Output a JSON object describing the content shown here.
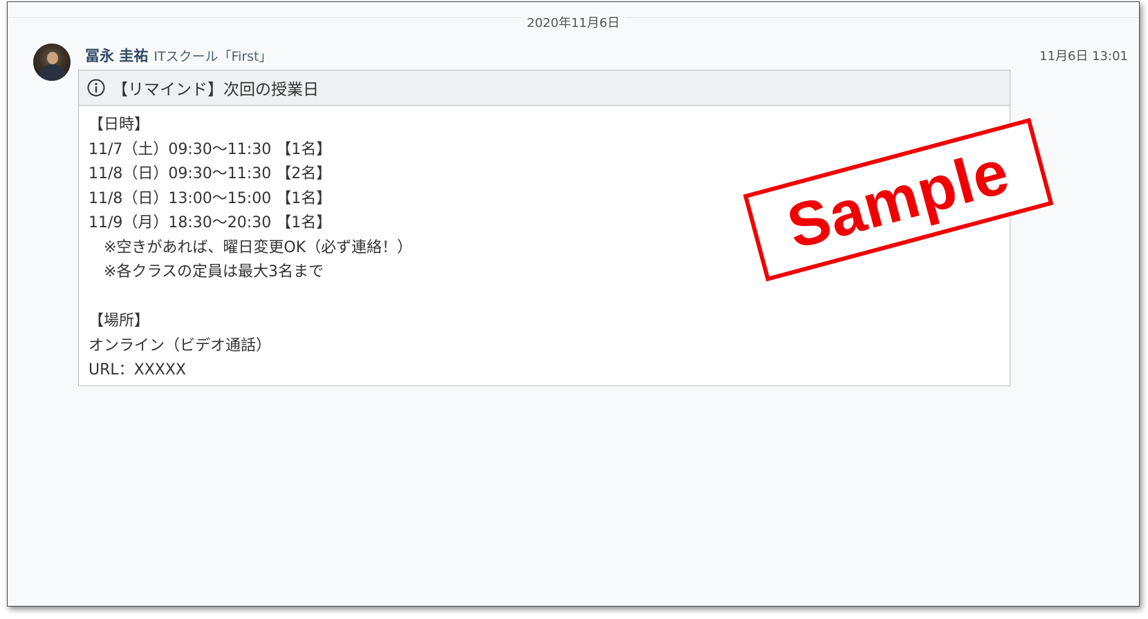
{
  "date_divider": "2020年11月6日",
  "message": {
    "author_name": "冨永 圭祐",
    "author_org": "ITスクール「First」",
    "timestamp": "11月6日 13:01",
    "card": {
      "icon": "info-icon",
      "title": "【リマインド】次回の授業日",
      "lines": [
        "【日時】",
        "11/7（土）09:30～11:30 【1名】",
        "11/8（日）09:30～11:30 【2名】",
        "11/8（日）13:00～15:00 【1名】",
        "11/9（月）18:30～20:30 【1名】",
        "　※空きがあれば、曜日変更OK（必ず連絡！）",
        "　※各クラスの定員は最大3名まで",
        "",
        "【場所】",
        "オンライン（ビデオ通話）",
        "URL：XXXXX"
      ]
    }
  },
  "stamp": {
    "text": "Sample",
    "color": "#f00000"
  }
}
